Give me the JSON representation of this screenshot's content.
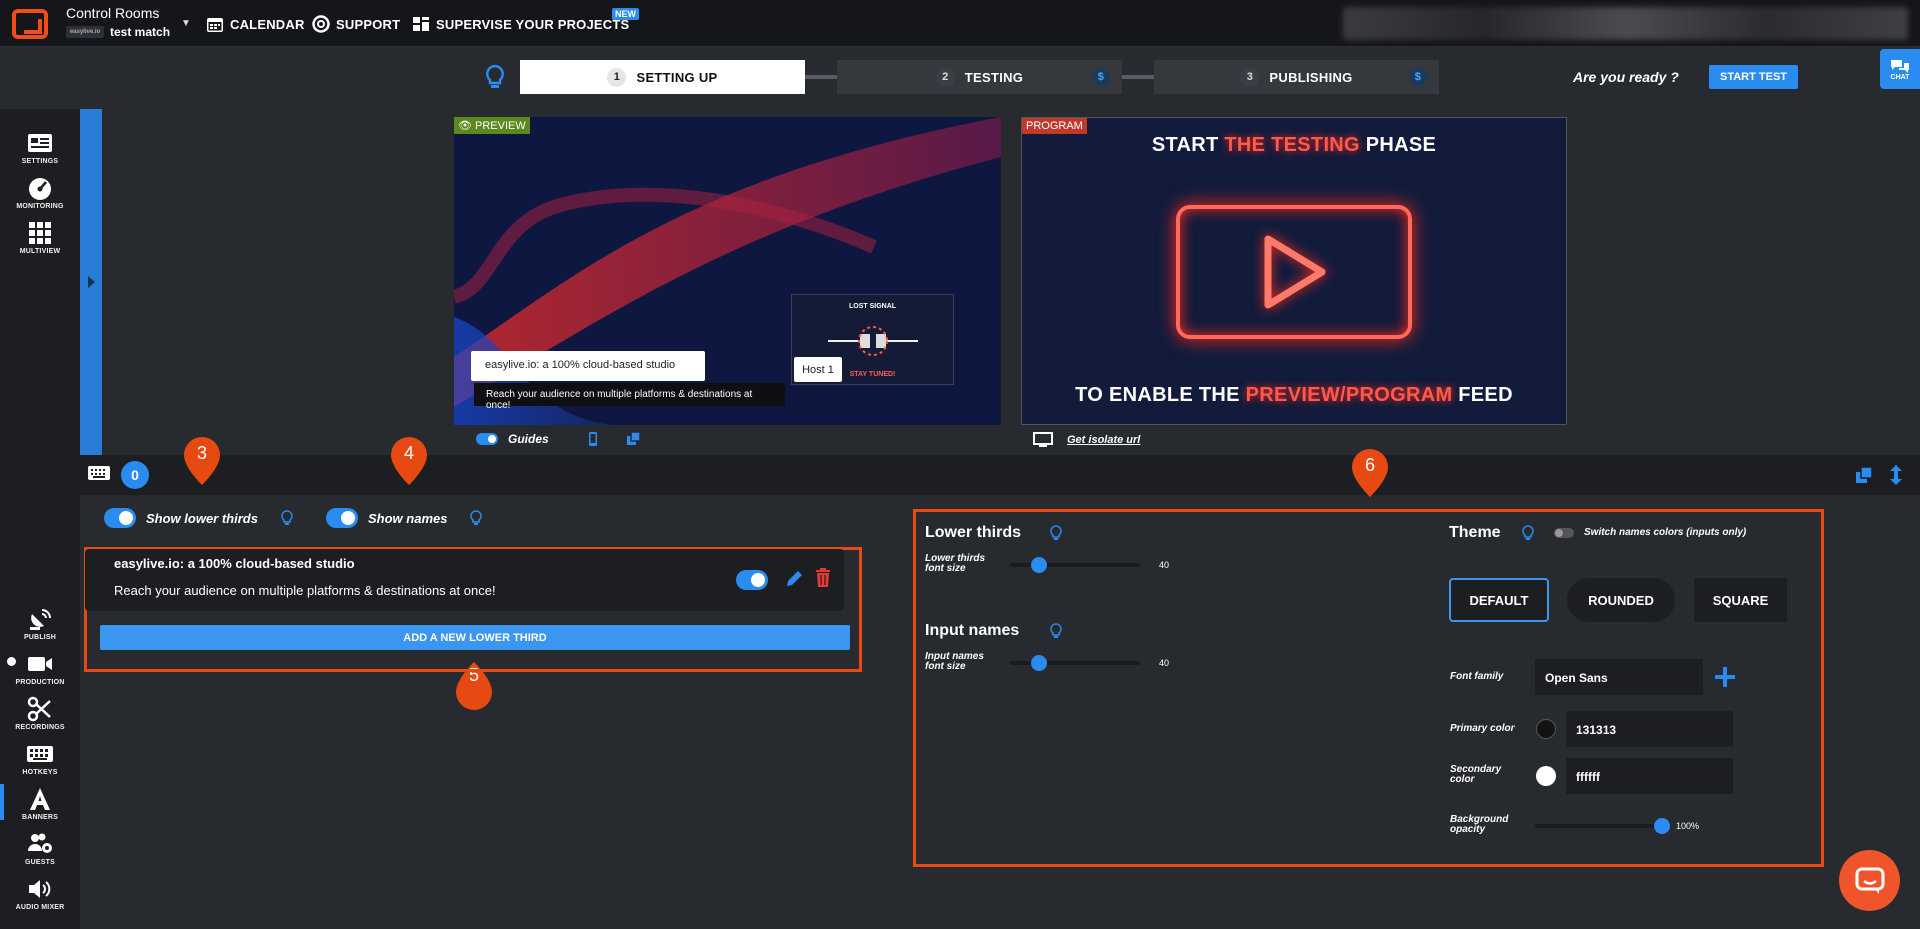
{
  "header": {
    "app_title": "Control Rooms",
    "project_name": "test match",
    "project_logo_text": "easylive.io",
    "nav": {
      "calendar": "CALENDAR",
      "support": "SUPPORT",
      "supervise": "SUPERVISE YOUR PROJECTS",
      "new_badge": "NEW"
    }
  },
  "steps": [
    {
      "num": "1",
      "label": "SETTING UP"
    },
    {
      "num": "2",
      "label": "TESTING",
      "badge": "$"
    },
    {
      "num": "3",
      "label": "PUBLISHING",
      "badge": "$"
    }
  ],
  "ready_text": "Are you ready ?",
  "start_test": "START TEST",
  "chat_label": "CHAT",
  "sidebar_top": [
    {
      "label": "SETTINGS",
      "icon": "settings-icon"
    },
    {
      "label": "MONITORING",
      "icon": "gauge-icon"
    },
    {
      "label": "MULTIVIEW",
      "icon": "grid-icon"
    }
  ],
  "sidebar_bottom": [
    {
      "label": "PUBLISH",
      "icon": "satellite-icon"
    },
    {
      "label": "PRODUCTION",
      "icon": "camera-icon"
    },
    {
      "label": "RECORDINGS",
      "icon": "scissors-icon"
    },
    {
      "label": "HOTKEYS",
      "icon": "keyboard-icon"
    },
    {
      "label": "BANNERS",
      "icon": "letter-a-icon"
    },
    {
      "label": "GUESTS",
      "icon": "users-gear-icon"
    },
    {
      "label": "AUDIO MIXER",
      "icon": "speaker-icon"
    }
  ],
  "preview": {
    "tag": "PREVIEW",
    "lower_third_title": "easylive.io: a 100% cloud-based studio",
    "lower_third_sub": "Reach your audience on multiple platforms & destinations at once!",
    "host_name": "Host 1",
    "lost_signal": "LOST SIGNAL",
    "stay_tuned": "STAY TUNED!",
    "guides_label": "Guides"
  },
  "program": {
    "tag": "PROGRAM",
    "top_a": "START ",
    "top_b": "THE TESTING",
    "top_c": " PHASE",
    "bottom_a": "TO ENABLE THE ",
    "bottom_b": "PREVIEW/PROGRAM",
    "bottom_c": " FEED",
    "isolate_link": "Get isolate url"
  },
  "counter": "0",
  "markers": [
    "3",
    "4",
    "5",
    "6"
  ],
  "banners": {
    "show_lower_thirds": "Show lower thirds",
    "show_names": "Show names",
    "item_title": "easylive.io: a 100% cloud-based studio",
    "item_sub": "Reach your audience on multiple platforms & destinations at once!",
    "add_button": "ADD A NEW LOWER THIRD"
  },
  "settings": {
    "lower_thirds_heading": "Lower thirds",
    "lt_font_label_1": "Lower thirds",
    "lt_font_label_2": "font size",
    "lt_font_value": "40",
    "lt_font_fraction": 0.22,
    "input_names_heading": "Input names",
    "in_font_label_1": "Input names",
    "in_font_label_2": "font size",
    "in_font_value": "40",
    "in_font_fraction": 0.22,
    "theme_heading": "Theme",
    "switch_colors": "Switch names colors (inputs only)",
    "themes": [
      "DEFAULT",
      "ROUNDED",
      "SQUARE"
    ],
    "selected_theme": "DEFAULT",
    "font_family_label": "Font family",
    "font_family_value": "Open Sans",
    "primary_label": "Primary color",
    "primary_value": "131313",
    "secondary_label_1": "Secondary",
    "secondary_label_2": "color",
    "secondary_value": "ffffff",
    "bg_label_1": "Background",
    "bg_label_2": "opacity",
    "bg_value": "100%",
    "bg_fraction": 1.0
  },
  "colors": {
    "accent": "#2a8cf0",
    "annotation": "#e64a12",
    "delete": "#e53935",
    "primary_swatch": "#131313",
    "secondary_swatch": "#ffffff"
  }
}
